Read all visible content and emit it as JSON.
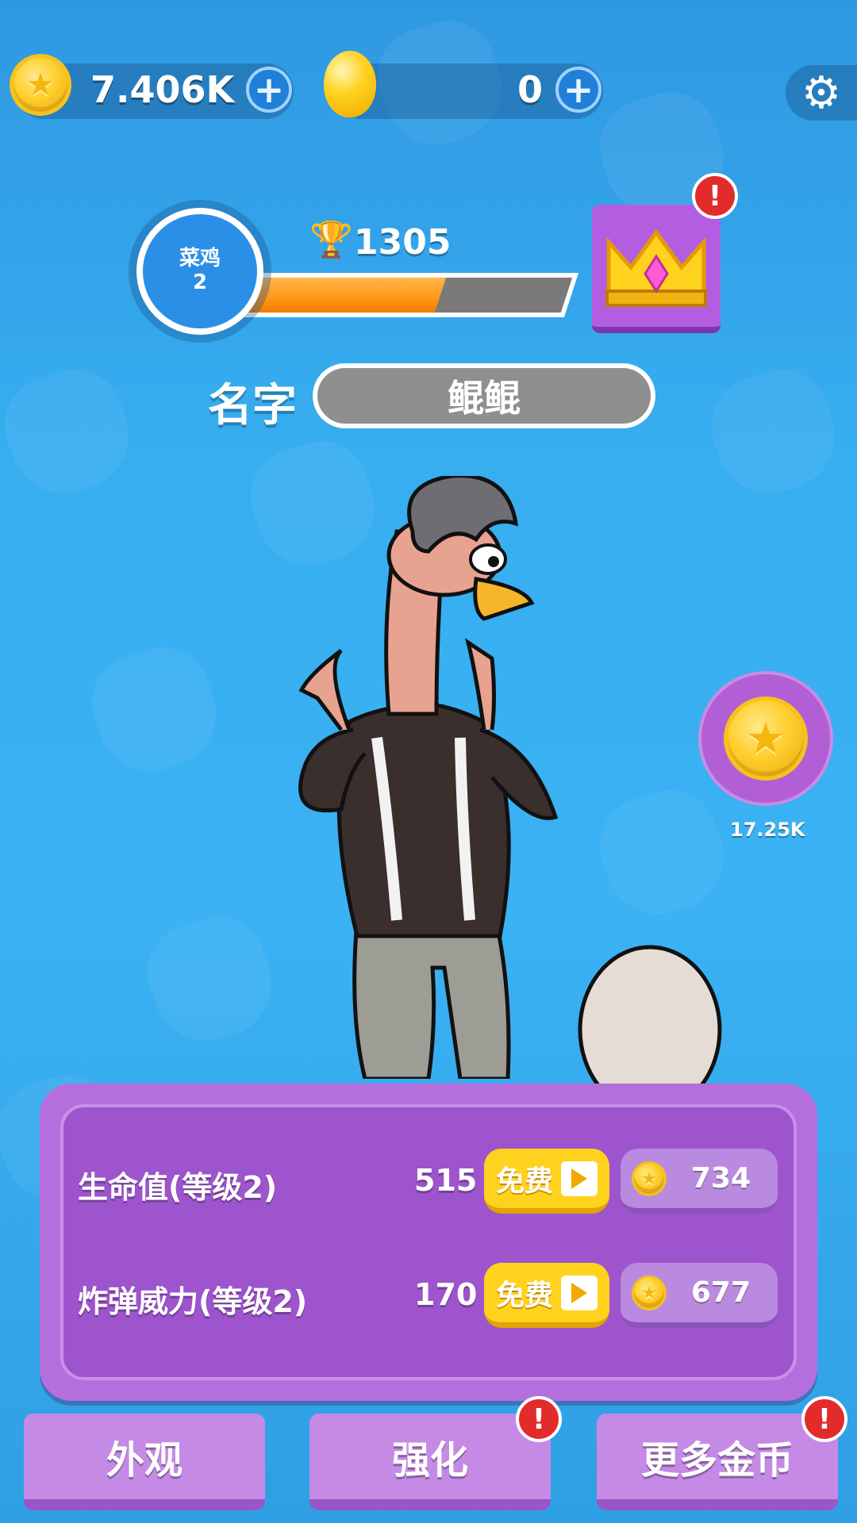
{
  "top_bar": {
    "coins": "7.406K",
    "gems": "0"
  },
  "rank": {
    "title": "菜鸡",
    "level": "2",
    "trophies": "1305",
    "progress": 0.62
  },
  "name": {
    "label": "名字",
    "value": "鲲鲲"
  },
  "side_reward": {
    "amount": "17.25K"
  },
  "upgrades": [
    {
      "label": "生命值(等级2)",
      "value": "515",
      "free_label": "免费",
      "cost": "734"
    },
    {
      "label": "炸弹威力(等级2)",
      "value": "170",
      "free_label": "免费",
      "cost": "677"
    }
  ],
  "nav": {
    "appearance": "外观",
    "strengthen": "强化",
    "more_coins": "更多金币"
  },
  "icons": {
    "coin": "star-coin-icon",
    "gem": "gold-egg-icon",
    "settings": "gear-icon",
    "trophy": "trophy-icon",
    "crown": "crown-icon",
    "alert": "exclamation-icon",
    "video": "play-video-icon"
  }
}
